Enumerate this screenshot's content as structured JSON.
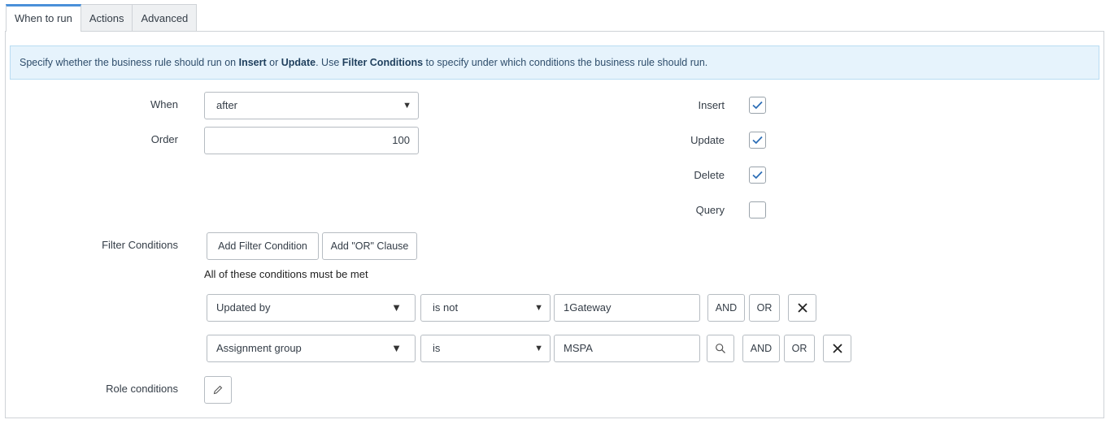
{
  "tabs": [
    {
      "label": "When to run"
    },
    {
      "label": "Actions"
    },
    {
      "label": "Advanced"
    }
  ],
  "info": {
    "part1": "Specify whether the business rule should run on ",
    "insert": "Insert",
    "part2": " or ",
    "update": "Update",
    "part3": ". Use ",
    "filter": "Filter Conditions",
    "part4": " to specify under which conditions the business rule should run."
  },
  "form": {
    "when_label": "When",
    "when_value": "after",
    "order_label": "Order",
    "order_value": "100",
    "filter_label": "Filter Conditions",
    "role_label": "Role conditions"
  },
  "operations": [
    {
      "label": "Insert",
      "checked": true
    },
    {
      "label": "Update",
      "checked": true
    },
    {
      "label": "Delete",
      "checked": true
    },
    {
      "label": "Query",
      "checked": false
    }
  ],
  "filter": {
    "add_condition": "Add Filter Condition",
    "add_or": "Add \"OR\" Clause",
    "met_text": "All of these conditions must be met",
    "rows": [
      {
        "field": "Updated by",
        "operator": "is not",
        "value": "1Gateway",
        "and": "AND",
        "or": "OR"
      },
      {
        "field": "Assignment group",
        "operator": "is",
        "value": "MSPA",
        "and": "AND",
        "or": "OR"
      }
    ]
  },
  "icons": {
    "caret": "▼",
    "search": "search-icon",
    "close": "close-icon",
    "edit": "pencil-icon"
  },
  "colors": {
    "accent": "#4a90d9",
    "check": "#2e6fb7",
    "info_bg": "#e6f3fc"
  }
}
